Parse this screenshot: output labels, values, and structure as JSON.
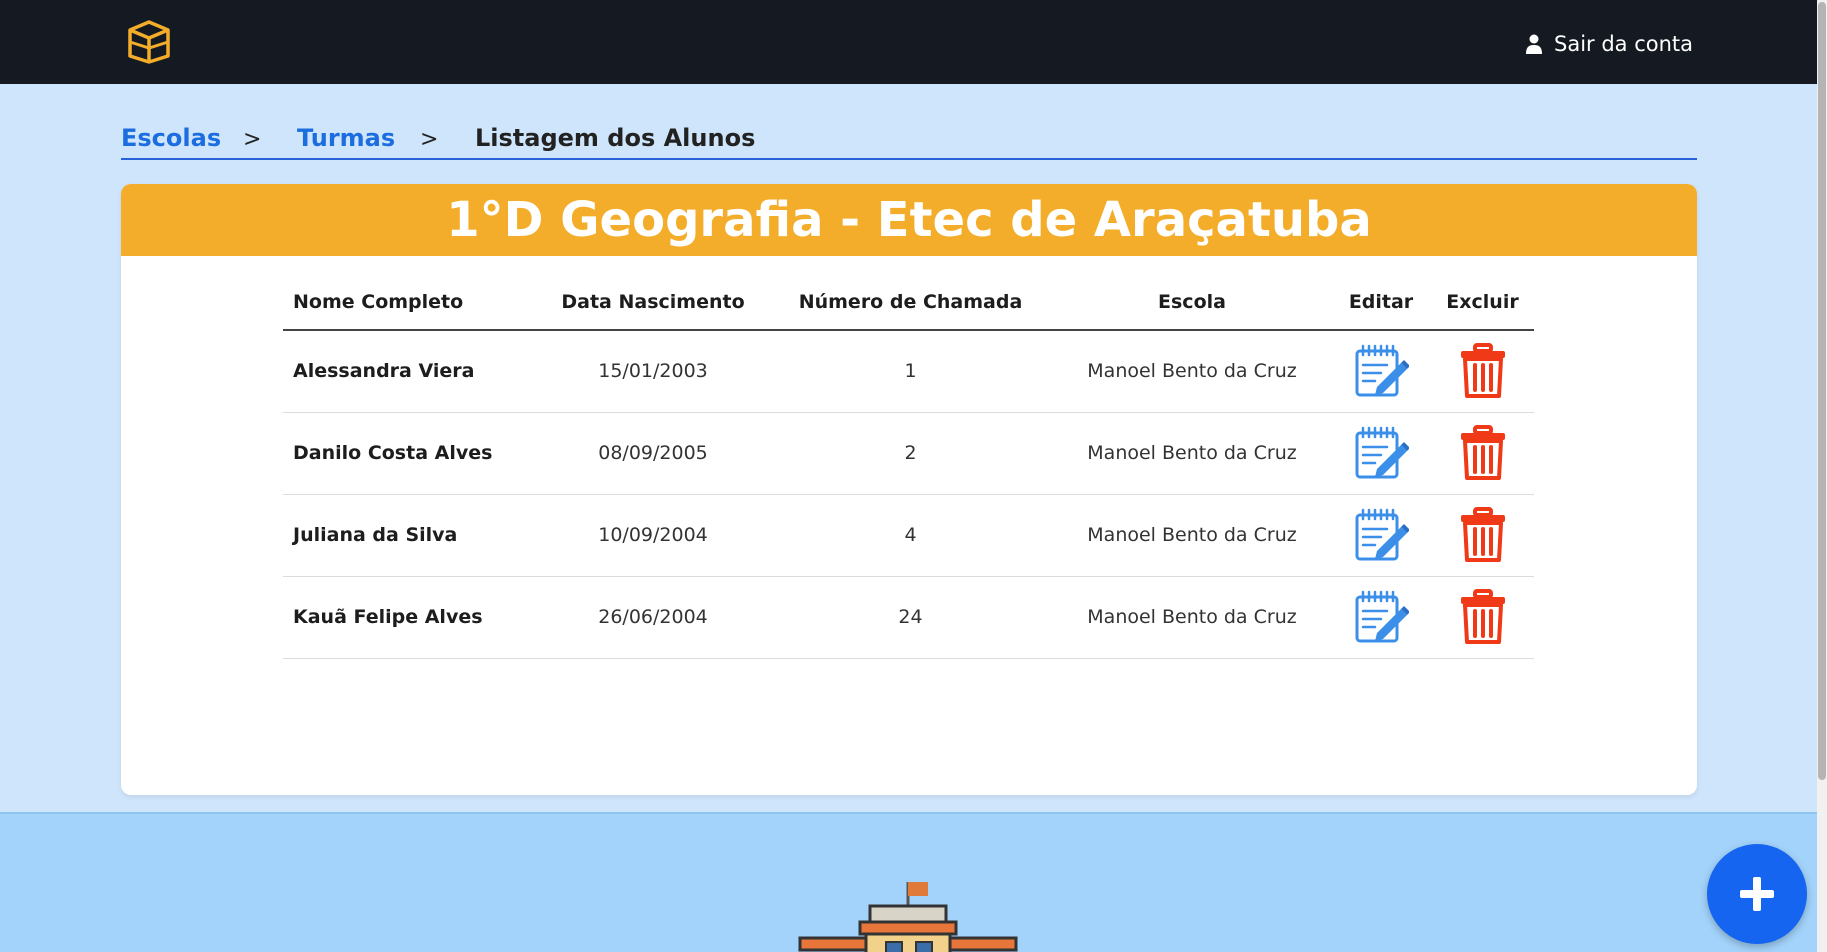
{
  "navbar": {
    "logo_icon": "open-box-icon",
    "account_icon": "user-icon",
    "account_label": "Sair da conta"
  },
  "breadcrumb": {
    "items": [
      "Escolas",
      "Turmas",
      "Listagem dos Alunos"
    ],
    "separator": ">"
  },
  "card": {
    "title": "1°D Geografia - Etec de Araçatuba",
    "header_color": "#f4ad2a"
  },
  "table": {
    "headers": [
      "Nome Completo",
      "Data Nascimento",
      "Número de Chamada",
      "Escola",
      "Editar",
      "Excluir"
    ],
    "rows": [
      {
        "name": "Alessandra Viera",
        "birth": "15/01/2003",
        "number": "1",
        "school": "Manoel Bento da Cruz"
      },
      {
        "name": "Danilo Costa Alves",
        "birth": "08/09/2005",
        "number": "2",
        "school": "Manoel Bento da Cruz"
      },
      {
        "name": "Juliana da Silva",
        "birth": "10/09/2004",
        "number": "4",
        "school": "Manoel Bento da Cruz"
      },
      {
        "name": "Kauã Felipe Alves",
        "birth": "26/06/2004",
        "number": "24",
        "school": "Manoel Bento da Cruz"
      }
    ],
    "edit_icon": "edit-notepad-icon",
    "delete_icon": "trash-icon"
  },
  "fab": {
    "icon": "plus-icon"
  },
  "colors": {
    "navbar": "#151a22",
    "background": "#cfe5fb",
    "link": "#1c6ee0",
    "delete": "#f03a17",
    "edit": "#3b8fe8",
    "fab": "#1565f0",
    "footer": "#a3d3fb"
  }
}
